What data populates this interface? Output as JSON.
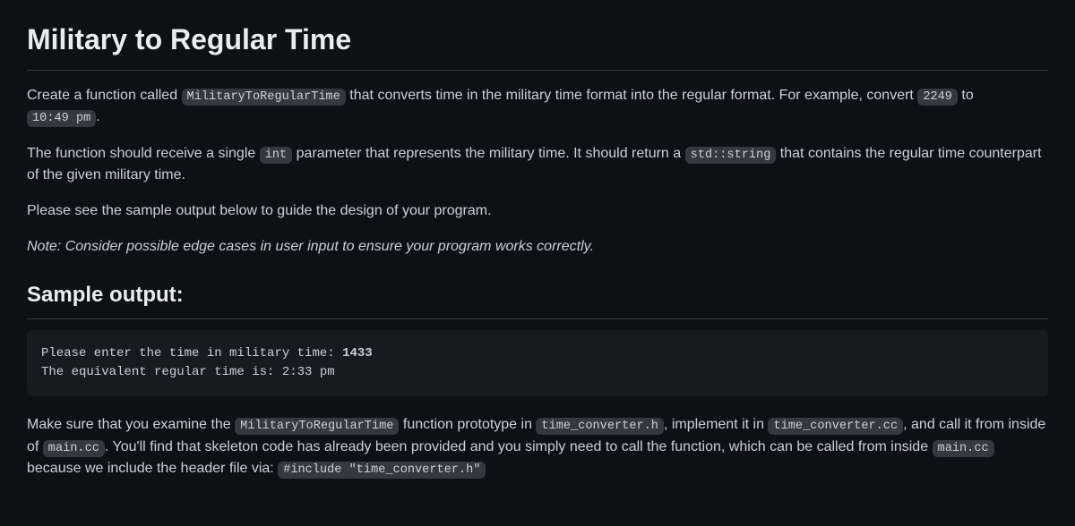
{
  "title": "Military to Regular Time",
  "p1": {
    "t1": "Create a function called ",
    "c1": "MilitaryToRegularTime",
    "t2": " that converts time in the military time format into the regular format. For example, convert ",
    "c2": "2249",
    "t3": " to ",
    "c3": "10:49 pm",
    "t4": "."
  },
  "p2": {
    "t1": "The function should receive a single ",
    "c1": "int",
    "t2": " parameter that represents the military time. It should return a ",
    "c2": "std::string",
    "t3": " that contains the regular time counterpart of the given military time."
  },
  "p3": "Please see the sample output below to guide the design of your program.",
  "p4": "Note: Consider possible edge cases in user input to ensure your program works correctly.",
  "sample_heading": "Sample output:",
  "sample_output": {
    "line1_prefix": "Please enter the time in military time: ",
    "line1_input": "1433",
    "line2": "The equivalent regular time is: 2:33 pm"
  },
  "p5": {
    "t1": "Make sure that you examine the ",
    "c1": "MilitaryToRegularTime",
    "t2": " function prototype in ",
    "c2": "time_converter.h",
    "t3": ", implement it in ",
    "c3": "time_converter.cc",
    "t4": ", and call it from inside of ",
    "c4": "main.cc",
    "t5": ". You'll find that skeleton code has already been provided and you simply need to call the function, which can be called from inside ",
    "c5": "main.cc",
    "t6": " because we include the header file via: ",
    "c6": "#include \"time_converter.h\""
  }
}
